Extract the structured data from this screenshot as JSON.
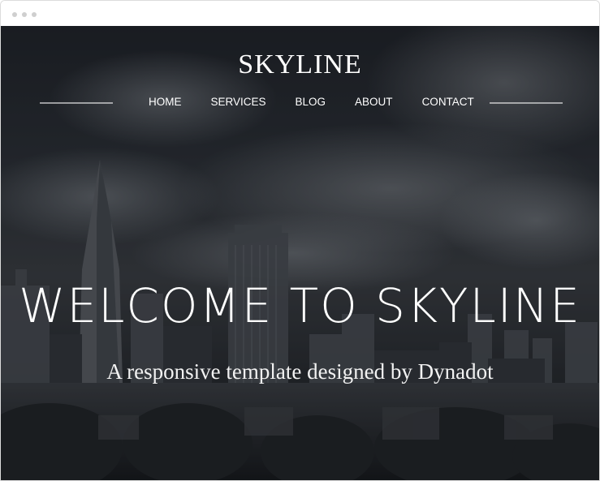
{
  "window": {
    "controls": [
      "dot",
      "dot",
      "dot"
    ]
  },
  "hero": {
    "brand": "SKYLINE",
    "nav": {
      "items": [
        {
          "label": "HOME"
        },
        {
          "label": "SERVICES"
        },
        {
          "label": "BLOG"
        },
        {
          "label": "ABOUT"
        },
        {
          "label": "CONTACT"
        }
      ]
    },
    "headline": "WELCOME TO SKYLINE",
    "subheadline": "A responsive template designed by Dynadot"
  },
  "colors": {
    "text": "#ffffff",
    "sky_dark": "#1f2329",
    "window_border": "#dcdcdc"
  }
}
